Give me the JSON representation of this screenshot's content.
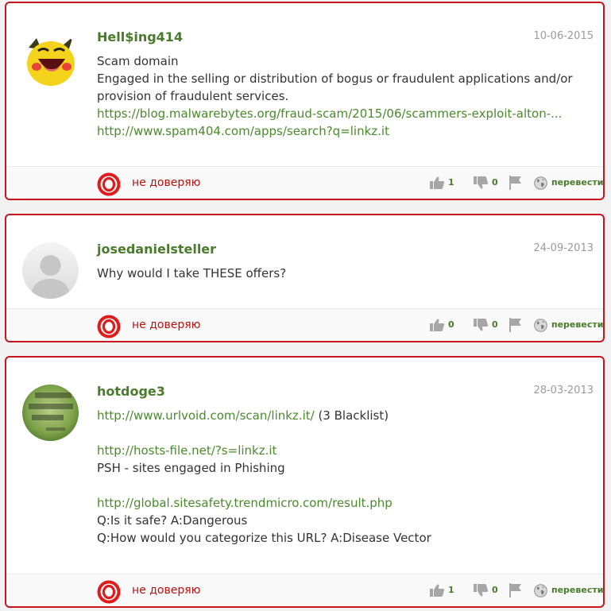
{
  "comments": [
    {
      "username": "Hell$ing414",
      "date": "10-06-2015",
      "body": {
        "line1": "Scam domain",
        "line2": "Engaged in the selling or distribution of bogus or fraudulent applications and/or provision of fraudulent services.",
        "link1": "https://blog.malwarebytes.org/fraud-scam/2015/06/scammers-exploit-alton-...",
        "link2": "http://www.spam404.com/apps/search?q=linkz.it"
      },
      "rating_label": "не доверяю",
      "likes": "1",
      "dislikes": "0",
      "translate_label": "перевести",
      "avatar_icon": "cartoon-pikachu-avatar"
    },
    {
      "username": "josedanielsteller",
      "date": "24-09-2013",
      "body": {
        "line1": "Why would I take THESE offers?"
      },
      "rating_label": "не доверяю",
      "likes": "0",
      "dislikes": "0",
      "translate_label": "перевести",
      "avatar_icon": "default-user-avatar"
    },
    {
      "username": "hotdoge3",
      "date": "28-03-2013",
      "body": {
        "link1": "http://www.urlvoid.com/scan/linkz.it/",
        "link1_suffix": " (3 Blacklist)",
        "link2": "http://hosts-file.net/?s=linkz.it",
        "line2": "PSH - sites engaged in Phishing",
        "link3": "http://global.sitesafety.trendmicro.com/result.php",
        "line3": "Q:Is it safe? A:Dangerous",
        "line4": "Q:How would you categorize this URL? A:Disease Vector"
      },
      "rating_label": "не доверяю",
      "likes": "1",
      "dislikes": "0",
      "translate_label": "перевести",
      "avatar_icon": "green-text-photo-avatar"
    }
  ],
  "colors": {
    "accent_red": "#c4161c",
    "username_green": "#4a7a2c",
    "link_green": "#4a8a2c",
    "distrust_red": "#b5140f"
  }
}
